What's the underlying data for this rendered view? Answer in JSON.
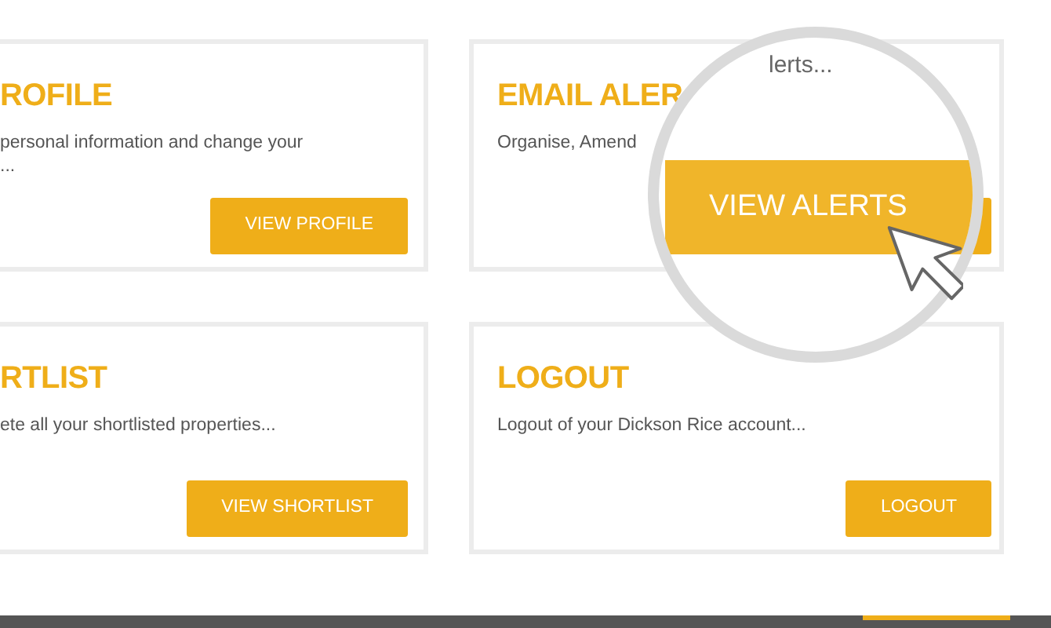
{
  "cards": [
    {
      "kind": "cut",
      "title": "ROFILE",
      "description": [
        "personal information and change your",
        "..."
      ],
      "button": "VIEW PROFILE"
    },
    {
      "kind": "full",
      "title": "EMAIL ALER",
      "description": [
        "Organise, Amend"
      ]
    },
    {
      "kind": "cut",
      "title": "RTLIST",
      "description": [
        "ete all your shortlisted properties..."
      ],
      "button": "VIEW SHORTLIST"
    },
    {
      "kind": "full",
      "title": "LOGOUT",
      "description": [
        "Logout of your Dickson Rice account..."
      ],
      "button": "LOGOUT"
    }
  ],
  "magnifier": {
    "text": "lerts...",
    "button": "VIEW ALERTS"
  }
}
